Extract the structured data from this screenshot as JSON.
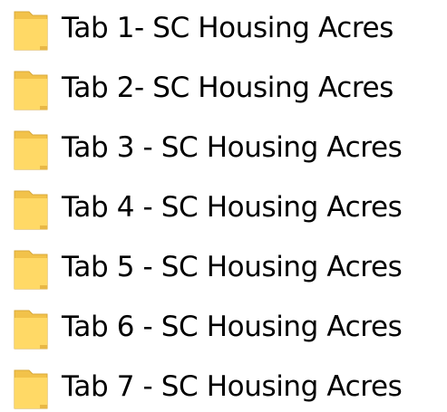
{
  "folders": [
    {
      "label": "Tab 1- SC Housing Acres",
      "icon": "folder-icon"
    },
    {
      "label": "Tab 2- SC Housing Acres",
      "icon": "folder-icon"
    },
    {
      "label": "Tab 3 - SC Housing Acres",
      "icon": "folder-icon"
    },
    {
      "label": "Tab 4 - SC Housing Acres",
      "icon": "folder-icon"
    },
    {
      "label": "Tab 5 - SC Housing Acres",
      "icon": "folder-icon"
    },
    {
      "label": "Tab 6 - SC Housing Acres",
      "icon": "folder-icon"
    },
    {
      "label": "Tab 7 - SC Housing Acres",
      "icon": "folder-icon"
    }
  ],
  "colors": {
    "folder_front": "#FFD966",
    "folder_back": "#F2C24A",
    "folder_edge": "#D9A93A"
  }
}
